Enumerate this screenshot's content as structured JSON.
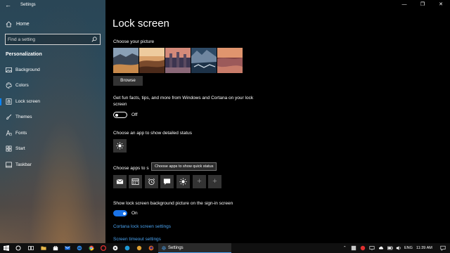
{
  "window": {
    "title": "Settings",
    "controls": [
      "—",
      "❐",
      "✕"
    ]
  },
  "sidebar": {
    "home_label": "Home",
    "search_placeholder": "Find a setting",
    "section_label": "Personalization",
    "items": [
      {
        "label": "Background",
        "icon": "image-icon",
        "selected": false
      },
      {
        "label": "Colors",
        "icon": "palette-icon",
        "selected": false
      },
      {
        "label": "Lock screen",
        "icon": "lock-screen-icon",
        "selected": true
      },
      {
        "label": "Themes",
        "icon": "brush-icon",
        "selected": false
      },
      {
        "label": "Fonts",
        "icon": "font-icon",
        "selected": false
      },
      {
        "label": "Start",
        "icon": "start-icon",
        "selected": false
      },
      {
        "label": "Taskbar",
        "icon": "taskbar-icon",
        "selected": false
      }
    ]
  },
  "main": {
    "title": "Lock screen",
    "choose_picture_label": "Choose your picture",
    "browse_label": "Browse",
    "fun_facts_text": "Get fun facts, tips, and more from Windows and Cortana on your lock screen",
    "fun_facts_toggle": {
      "state": "Off",
      "on": false
    },
    "detailed_status_label": "Choose an app to show detailed status",
    "detailed_status_app_icon": "weather-sun-icon",
    "quick_status_label": "Choose apps to show quick status",
    "quick_status_label_visible": "Choose apps to s",
    "quick_status_tooltip": "Choose apps to show quick status",
    "quick_status_apps": [
      "mail-icon",
      "calendar-icon",
      "alarm-icon",
      "message-icon",
      "weather-sun-icon"
    ],
    "quick_status_add_slots": 2,
    "add_symbol": "+",
    "signin_bg_text": "Show lock screen background picture on the sign-in screen",
    "signin_toggle": {
      "state": "On",
      "on": true
    },
    "links": [
      "Cortana lock screen settings",
      "Screen timeout settings"
    ]
  },
  "taskbar": {
    "running_app_label": "Settings",
    "language": "ENG",
    "clock": "11:39 AM"
  },
  "colors": {
    "accent": "#1a73e8",
    "link": "#4aa3f0",
    "background": "#000000"
  }
}
